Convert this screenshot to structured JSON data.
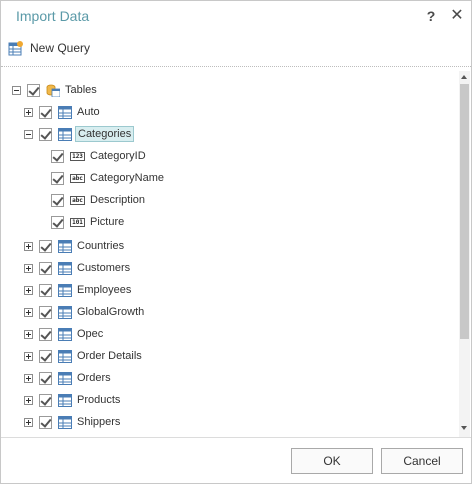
{
  "dialog": {
    "title": "Import Data",
    "help_label": "?",
    "close_label": "✕"
  },
  "toolbar": {
    "new_query_label": "New Query"
  },
  "tree": {
    "root_label": "Tables",
    "tables": [
      {
        "label": "Auto",
        "expanded": false,
        "checked": true
      },
      {
        "label": "Categories",
        "expanded": true,
        "checked": true,
        "selected": true
      },
      {
        "label": "Countries",
        "expanded": false,
        "checked": true
      },
      {
        "label": "Customers",
        "expanded": false,
        "checked": true
      },
      {
        "label": "Employees",
        "expanded": false,
        "checked": true
      },
      {
        "label": "GlobalGrowth",
        "expanded": false,
        "checked": true
      },
      {
        "label": "Opec",
        "expanded": false,
        "checked": true
      },
      {
        "label": "Order Details",
        "expanded": false,
        "checked": true
      },
      {
        "label": "Orders",
        "expanded": false,
        "checked": true
      },
      {
        "label": "Products",
        "expanded": false,
        "checked": true
      },
      {
        "label": "Shippers",
        "expanded": false,
        "checked": true
      }
    ],
    "categories_fields": [
      {
        "label": "CategoryID",
        "type_glyph": "123",
        "icon": "number-field-icon"
      },
      {
        "label": "CategoryName",
        "type_glyph": "abc",
        "icon": "text-field-icon"
      },
      {
        "label": "Description",
        "type_glyph": "abc",
        "icon": "text-field-icon"
      },
      {
        "label": "Picture",
        "type_glyph": "101",
        "icon": "binary-field-icon"
      }
    ]
  },
  "footer": {
    "ok_label": "OK",
    "cancel_label": "Cancel"
  },
  "colors": {
    "title": "#5b9aa8",
    "selection_bg": "#d8eef0",
    "selection_border": "#9cc9cf",
    "table_icon": "#4a7db5"
  }
}
